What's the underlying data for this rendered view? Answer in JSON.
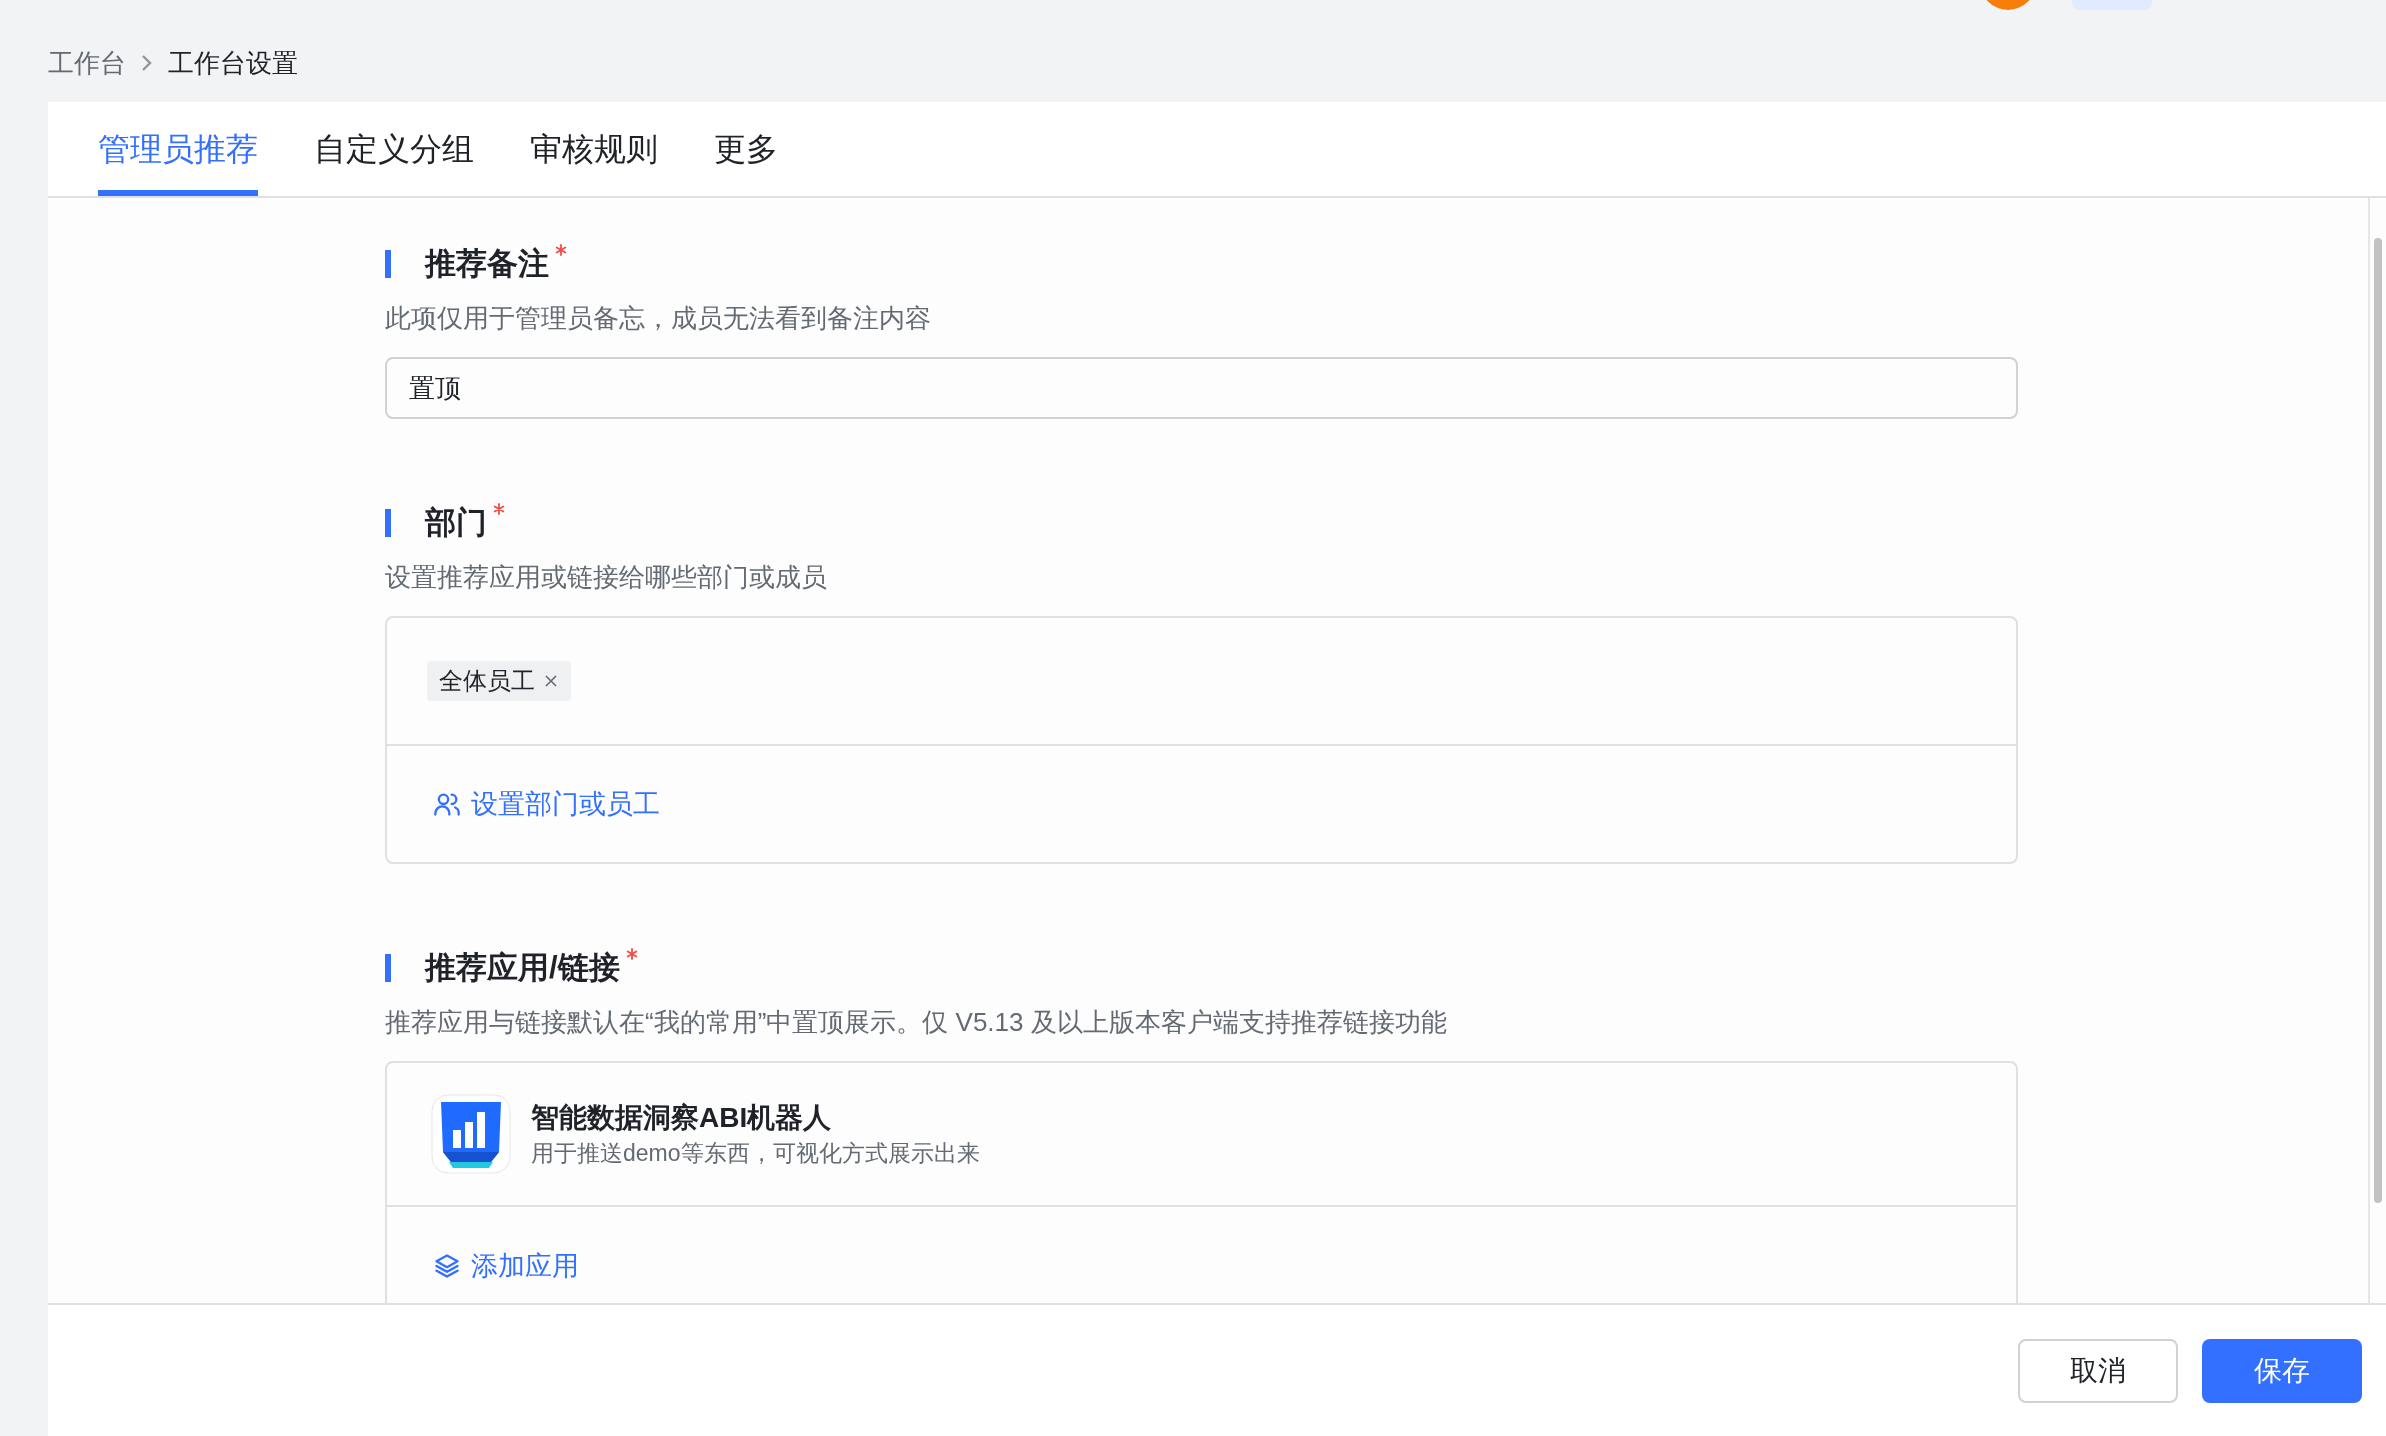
{
  "breadcrumb": [
    {
      "label": "工作台"
    },
    {
      "label": "工作台设置"
    }
  ],
  "tabs": [
    {
      "label": "管理员推荐",
      "selected": true
    },
    {
      "label": "自定义分组",
      "selected": false
    },
    {
      "label": "审核规则",
      "selected": false
    },
    {
      "label": "更多",
      "selected": false
    }
  ],
  "sections": [
    {
      "kind": "text",
      "title": "推荐备注",
      "required": true,
      "description": "此项仅用于管理员备忘，成员无法看到备注内容",
      "value": "置顶"
    },
    {
      "kind": "members",
      "title": "部门",
      "required": true,
      "description": "设置推荐应用或链接给哪些部门或成员",
      "tags": [
        {
          "label": "全体员工"
        }
      ],
      "action": "设置部门或员工"
    },
    {
      "kind": "apps",
      "title": "推荐应用/链接",
      "required": true,
      "description": "推荐应用与链接默认在“我的常用”中置顶展示。仅 V5.13 及以上版本客户端支持推荐链接功能",
      "apps": [
        {
          "name": "智能数据洞察ABI机器人",
          "description": "用于推送demo等东西，可视化方式展示出来"
        }
      ],
      "action": "添加应用"
    }
  ],
  "footer": {
    "buttons": [
      {
        "label": "取消",
        "kind": "secondary"
      },
      {
        "label": "保存",
        "kind": "primary"
      }
    ]
  }
}
